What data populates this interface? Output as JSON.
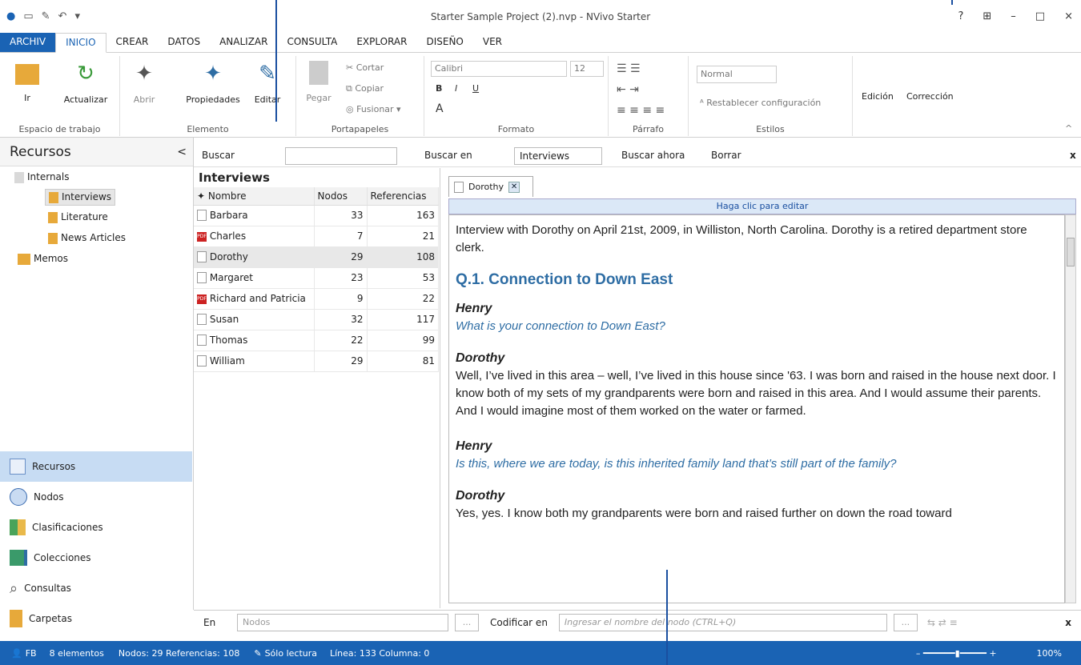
{
  "window": {
    "title": "Starter Sample Project (2).nvp - NVivo Starter",
    "help": "?"
  },
  "tabs": [
    "ARCHIV",
    "INICIO",
    "CREAR",
    "DATOS",
    "ANALIZAR",
    "CONSULTA",
    "EXPLORAR",
    "DISEÑO",
    "VER"
  ],
  "ribbon": {
    "workspace": {
      "label": "Espacio de trabajo",
      "go": "Ir",
      "refresh": "Actualizar"
    },
    "item": {
      "label": "Elemento",
      "open": "Abrir",
      "properties": "Propiedades",
      "edit": "Editar"
    },
    "clipboard": {
      "label": "Portapapeles",
      "paste": "Pegar",
      "cut": "Cortar",
      "copy": "Copiar",
      "merge": "Fusionar"
    },
    "format": {
      "label": "Formato",
      "font": "Calibri",
      "size": "12",
      "bold": "B",
      "italic": "I",
      "underline": "U",
      "color": "A"
    },
    "paragraph": {
      "label": "Párrafo"
    },
    "styles": {
      "label": "Estilos",
      "style": "Normal",
      "reset": "Restablecer configuración"
    },
    "edition": "Edición",
    "correction": "Corrección"
  },
  "search": {
    "find": "Buscar",
    "find_in": "Buscar en",
    "scope": "Interviews",
    "find_now": "Buscar ahora",
    "clear": "Borrar",
    "close": "x"
  },
  "left_pane": {
    "title": "Recursos",
    "collapse": "<",
    "tree": {
      "internals": "Internals",
      "interviews": "Interviews",
      "literature": "Literature",
      "news": "News Articles",
      "memos": "Memos"
    },
    "nav": [
      "Recursos",
      "Nodos",
      "Clasificaciones",
      "Colecciones",
      "Consultas",
      "Carpetas"
    ]
  },
  "list": {
    "title": "Interviews",
    "headers": [
      "Nombre",
      "Nodos",
      "Referencias"
    ],
    "rows": [
      {
        "name": "Barbara",
        "nodes": "33",
        "refs": "163",
        "pdf": false
      },
      {
        "name": "Charles",
        "nodes": "7",
        "refs": "21",
        "pdf": true
      },
      {
        "name": "Dorothy",
        "nodes": "29",
        "refs": "108",
        "pdf": false
      },
      {
        "name": "Margaret",
        "nodes": "23",
        "refs": "53",
        "pdf": false
      },
      {
        "name": "Richard and Patricia",
        "nodes": "9",
        "refs": "22",
        "pdf": true
      },
      {
        "name": "Susan",
        "nodes": "32",
        "refs": "117",
        "pdf": false
      },
      {
        "name": "Thomas",
        "nodes": "22",
        "refs": "99",
        "pdf": false
      },
      {
        "name": "William",
        "nodes": "29",
        "refs": "81",
        "pdf": false
      }
    ]
  },
  "doc": {
    "tab": "Dorothy",
    "edit_hint": "Haga clic para editar",
    "intro": "Interview with Dorothy on April 21st, 2009, in Williston, North Carolina. Dorothy is a retired department store clerk.",
    "heading": "Q.1. Connection to Down East",
    "s1": "Henry",
    "q1": "What is your connection to Down East?",
    "s2": "Dorothy",
    "a1": "Well, I’ve lived in this area – well, I’ve lived in this house since '63. I was born and raised in the house next door. I know both of my sets of my grandparents were born and raised in this area. And I would assume their parents. And I would imagine most of them worked on the water or farmed.",
    "s3": "Henry",
    "q2": "Is this, where we are today, is this inherited family land that’s still part of the family?",
    "s4": "Dorothy",
    "a2": "Yes, yes. I know both my grandparents were born and raised further on down the road toward"
  },
  "codebar": {
    "in": "En",
    "nodes": "Nodos",
    "dots": "...",
    "code_in": "Codificar en",
    "placeholder": "Ingresar el nombre del nodo (CTRL+Q)",
    "close": "x"
  },
  "status": {
    "user": "FB",
    "items": "8 elementos",
    "info": "Nodos: 29  Referencias: 108",
    "readonly": "Sólo lectura",
    "pos": "Línea: 133  Columna: 0",
    "zoom": "100%"
  }
}
